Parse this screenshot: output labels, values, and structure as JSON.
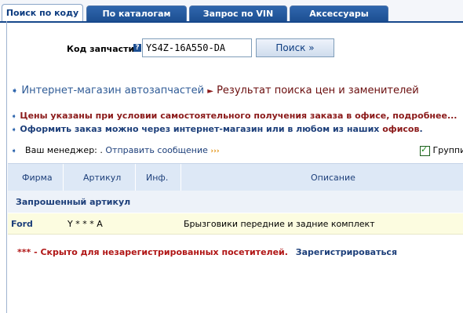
{
  "tabs": [
    {
      "label": "Поиск по коду",
      "active": true
    },
    {
      "label": "По каталогам",
      "active": false
    },
    {
      "label": "Запрос по VIN",
      "active": false
    },
    {
      "label": "Аксессуары",
      "active": false
    }
  ],
  "search": {
    "label": "Код запчасти:",
    "help_icon": "?",
    "value": "YS4Z-16A550-DA",
    "button": "Поиск »"
  },
  "breadcrumb": {
    "home": "Интернет-магазин автозапчастей",
    "current": "Результат поиска цен и заменителей"
  },
  "notes": {
    "prices": {
      "text": "Цены указаны при условии самостоятельного получения заказа в офисе, ",
      "link": "подробнее..."
    },
    "order": {
      "text": "Оформить заказ можно через интернет-магазин или в любом из наших ",
      "link": "офисов",
      "end": "."
    }
  },
  "manager": {
    "label": "Ваш менеджер: . ",
    "send": "Отправить сообщение",
    "chevrons": "›››"
  },
  "group_checkbox": {
    "label": "Группир",
    "checked": true
  },
  "table": {
    "headers": [
      "Фирма",
      "Артикул",
      "Инф.",
      "Описание"
    ],
    "section": "Запрошенный артикул",
    "rows": [
      {
        "brand": "Ford",
        "article": "Y * * * A",
        "info": "",
        "description": "Брызговики передние и задние комплект"
      }
    ]
  },
  "hidden_notice": {
    "text": "*** - Скрыто для незарегистрированных посетителей.",
    "register": "Зарегистрироваться"
  },
  "colors": {
    "nav_blue": "#1d4f92",
    "dark_red": "#8b1a1a",
    "row_yellow": "#fcfce0"
  }
}
